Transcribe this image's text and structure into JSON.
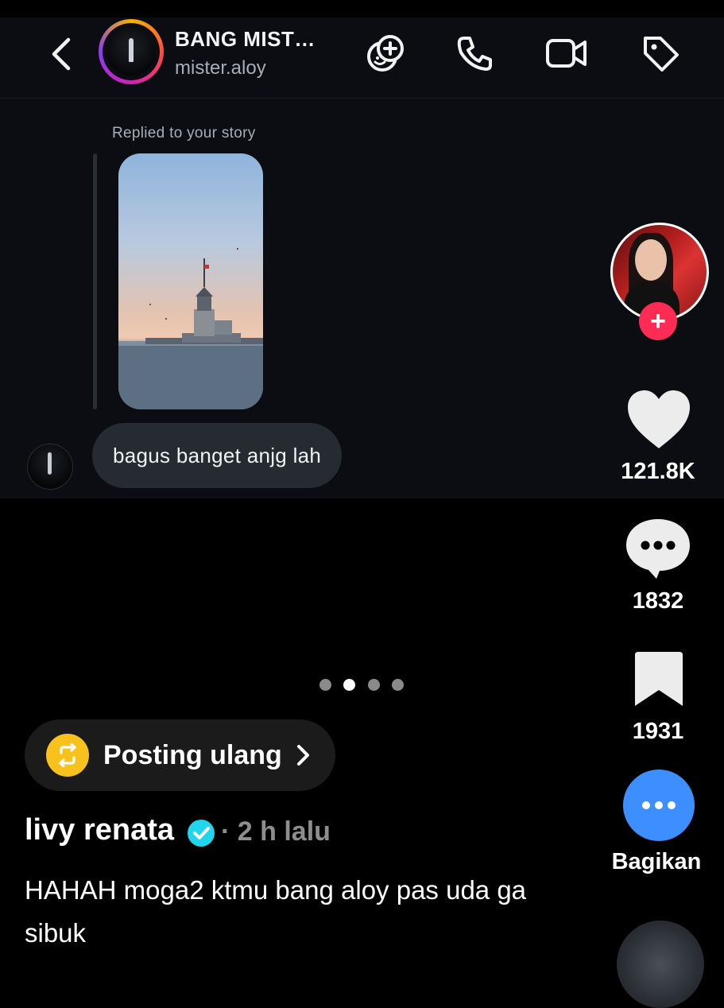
{
  "dm": {
    "header": {
      "name": "BANG MIST…",
      "username": "mister.aloy"
    },
    "reply_note": "Replied to your story",
    "message": "bagus banget anjg lah"
  },
  "rail": {
    "likes": "121.8K",
    "comments": "1832",
    "saves": "1931",
    "share_label": "Bagikan"
  },
  "pagination": {
    "count": 4,
    "active_index": 1
  },
  "repost": {
    "label": "Posting ulang"
  },
  "post": {
    "author": "livy renata",
    "meta": "· 2 h lalu",
    "caption": "HAHAH moga2 ktmu bang aloy pas uda ga sibuk"
  },
  "colors": {
    "like_accent": "#fe2c55",
    "share_blue": "#3d8eff",
    "repost_yellow": "#f8c21c",
    "verified_blue": "#20d5ec"
  },
  "icons": {
    "back": "chevron-left-icon",
    "effects": "face-plus-icon",
    "call": "phone-icon",
    "video": "video-camera-icon",
    "tag": "tag-icon",
    "like": "heart-icon",
    "comment": "speech-bubble-icon",
    "save": "bookmark-icon",
    "share": "more-dots-icon",
    "repost": "repost-arrows-icon",
    "verified": "verified-badge-icon"
  }
}
